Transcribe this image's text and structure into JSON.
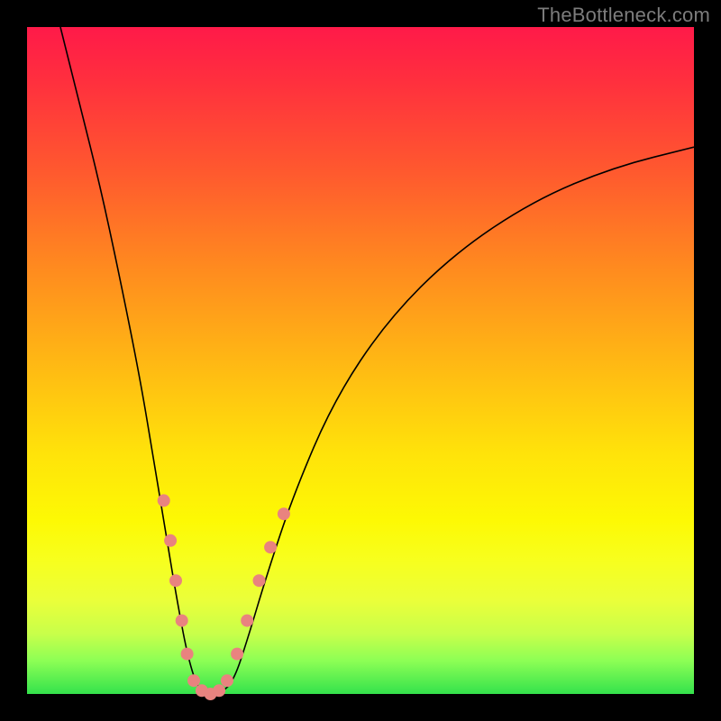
{
  "watermark": "TheBottleneck.com",
  "colors": {
    "frame": "#000000",
    "gradient_stops": [
      "#ff1a49",
      "#ff2f3e",
      "#ff5a2e",
      "#ff8a1f",
      "#ffb714",
      "#ffe30a",
      "#fdf904",
      "#f7ff1e",
      "#eaff3a",
      "#c8ff4a",
      "#8dff55",
      "#34e24c"
    ],
    "curve": "#000000",
    "dot": "#e9837f"
  },
  "chart_data": {
    "type": "line",
    "title": "",
    "xlabel": "",
    "ylabel": "",
    "xlim": [
      0,
      100
    ],
    "ylim": [
      0,
      100
    ],
    "note": "Axes are unlabeled; values are visual estimates in percent of plot width/height. y=0 at bottom, y=100 at top.",
    "series": [
      {
        "name": "bottleneck-curve",
        "points": [
          {
            "x": 5,
            "y": 100
          },
          {
            "x": 8,
            "y": 88
          },
          {
            "x": 11,
            "y": 76
          },
          {
            "x": 14,
            "y": 62
          },
          {
            "x": 17,
            "y": 47
          },
          {
            "x": 19,
            "y": 35
          },
          {
            "x": 21,
            "y": 23
          },
          {
            "x": 22.5,
            "y": 14
          },
          {
            "x": 24,
            "y": 6
          },
          {
            "x": 25.5,
            "y": 1
          },
          {
            "x": 27,
            "y": 0
          },
          {
            "x": 29,
            "y": 0
          },
          {
            "x": 31,
            "y": 2
          },
          {
            "x": 33,
            "y": 8
          },
          {
            "x": 36,
            "y": 18
          },
          {
            "x": 40,
            "y": 30
          },
          {
            "x": 46,
            "y": 44
          },
          {
            "x": 54,
            "y": 56
          },
          {
            "x": 64,
            "y": 66
          },
          {
            "x": 76,
            "y": 74
          },
          {
            "x": 88,
            "y": 79
          },
          {
            "x": 100,
            "y": 82
          }
        ]
      }
    ],
    "scatter": {
      "name": "marked-dots",
      "note": "Rounded salmon dots clustered along the curve near the minimum.",
      "points": [
        {
          "x": 20.5,
          "y": 29
        },
        {
          "x": 21.5,
          "y": 23
        },
        {
          "x": 22.3,
          "y": 17
        },
        {
          "x": 23.2,
          "y": 11
        },
        {
          "x": 24.0,
          "y": 6
        },
        {
          "x": 25.0,
          "y": 2
        },
        {
          "x": 26.2,
          "y": 0.5
        },
        {
          "x": 27.5,
          "y": 0
        },
        {
          "x": 28.8,
          "y": 0.5
        },
        {
          "x": 30.0,
          "y": 2
        },
        {
          "x": 31.5,
          "y": 6
        },
        {
          "x": 33.0,
          "y": 11
        },
        {
          "x": 34.8,
          "y": 17
        },
        {
          "x": 36.5,
          "y": 22
        },
        {
          "x": 38.5,
          "y": 27
        }
      ]
    }
  }
}
